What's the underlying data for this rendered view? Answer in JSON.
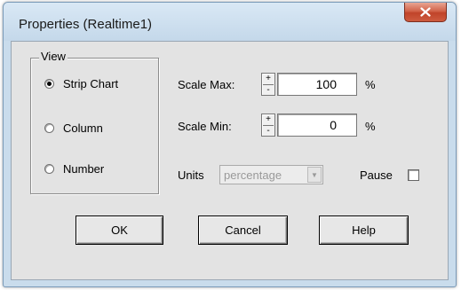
{
  "window": {
    "title": "Properties (Realtime1)",
    "close_glyph": "x"
  },
  "view_group": {
    "legend": "View",
    "options": [
      {
        "label": "Strip Chart",
        "checked": true
      },
      {
        "label": "Column",
        "checked": false
      },
      {
        "label": "Number",
        "checked": false
      }
    ]
  },
  "scale_max": {
    "label": "Scale Max:",
    "value": "100",
    "unit": "%"
  },
  "scale_min": {
    "label": "Scale Min:",
    "value": "0",
    "unit": "%"
  },
  "units": {
    "label": "Units",
    "selected": "percentage"
  },
  "pause": {
    "label": "Pause",
    "checked": false
  },
  "buttons": {
    "ok": "OK",
    "cancel": "Cancel",
    "help": "Help"
  },
  "colors": {
    "title_bar": "#c9dcec",
    "close_button": "#c7482d",
    "dialog_face": "#e3e3e3"
  }
}
